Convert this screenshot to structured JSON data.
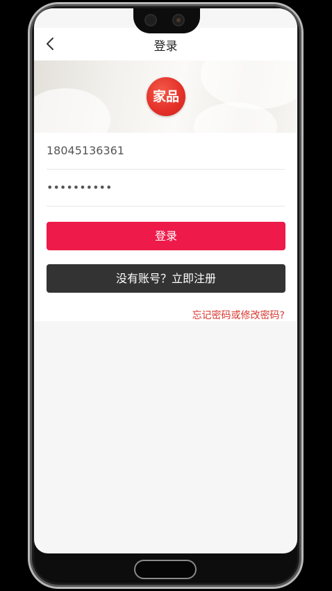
{
  "nav": {
    "back_icon": "chevron-left-icon",
    "title": "登录"
  },
  "banner": {
    "logo_text": "家品"
  },
  "form": {
    "phone_value": "18045136361",
    "password_value": "••••••••••",
    "login_label": "登录",
    "register_label": "没有账号？立即注册",
    "forgot_label": "忘记密码或修改密码?"
  },
  "colors": {
    "login_button": "#ee1a4a",
    "register_button": "#333333",
    "link": "#d9362e",
    "logo": "#e5322a"
  }
}
